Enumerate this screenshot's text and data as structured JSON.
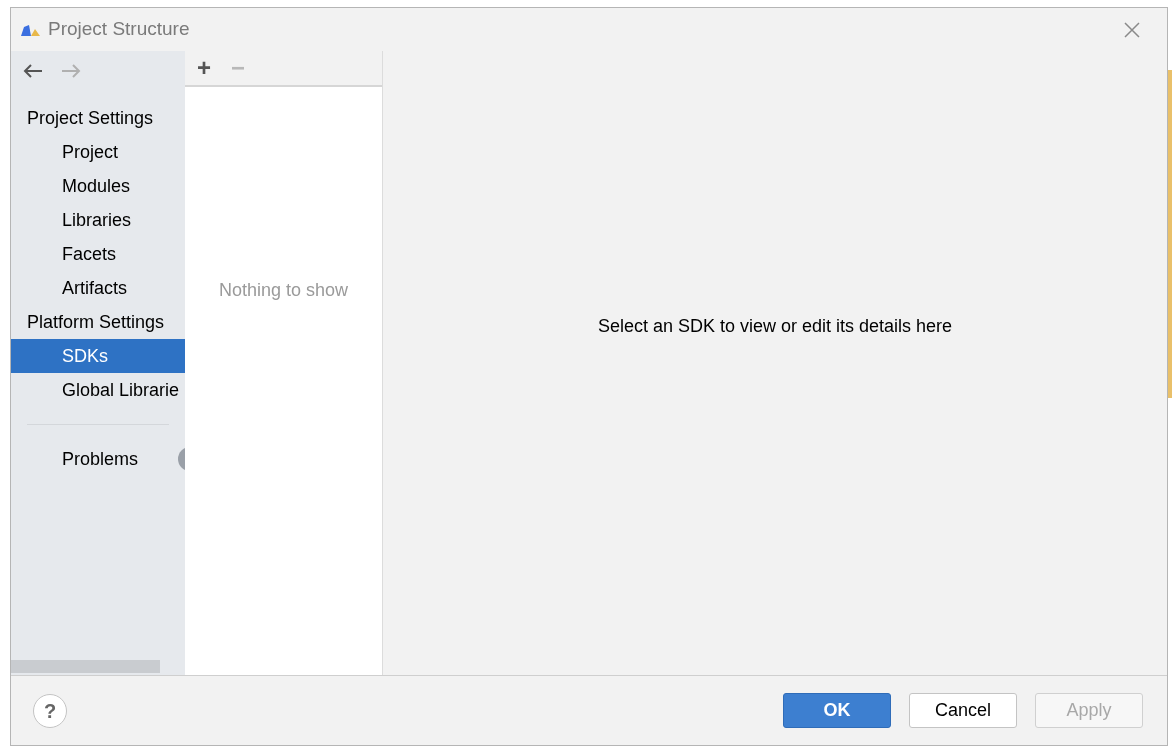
{
  "window": {
    "title": "Project Structure"
  },
  "sidebar": {
    "groups": [
      {
        "heading": "Project Settings",
        "items": [
          {
            "label": "Project",
            "selected": false
          },
          {
            "label": "Modules",
            "selected": false
          },
          {
            "label": "Libraries",
            "selected": false
          },
          {
            "label": "Facets",
            "selected": false
          },
          {
            "label": "Artifacts",
            "selected": false
          }
        ]
      },
      {
        "heading": "Platform Settings",
        "items": [
          {
            "label": "SDKs",
            "selected": true
          },
          {
            "label": "Global Librarie",
            "selected": false
          }
        ]
      }
    ],
    "problems": {
      "label": "Problems"
    }
  },
  "list": {
    "toolbar": [
      {
        "label": "+",
        "disabled": false
      },
      {
        "label": "−",
        "disabled": true
      }
    ],
    "empty_text": "Nothing to show"
  },
  "details": {
    "message": "Select an SDK to view or edit its details here"
  },
  "footer": {
    "help": "?",
    "buttons": [
      {
        "label": "OK",
        "kind": "primary",
        "disabled": false
      },
      {
        "label": "Cancel",
        "kind": "normal",
        "disabled": false
      },
      {
        "label": "Apply",
        "kind": "normal",
        "disabled": true
      }
    ]
  }
}
